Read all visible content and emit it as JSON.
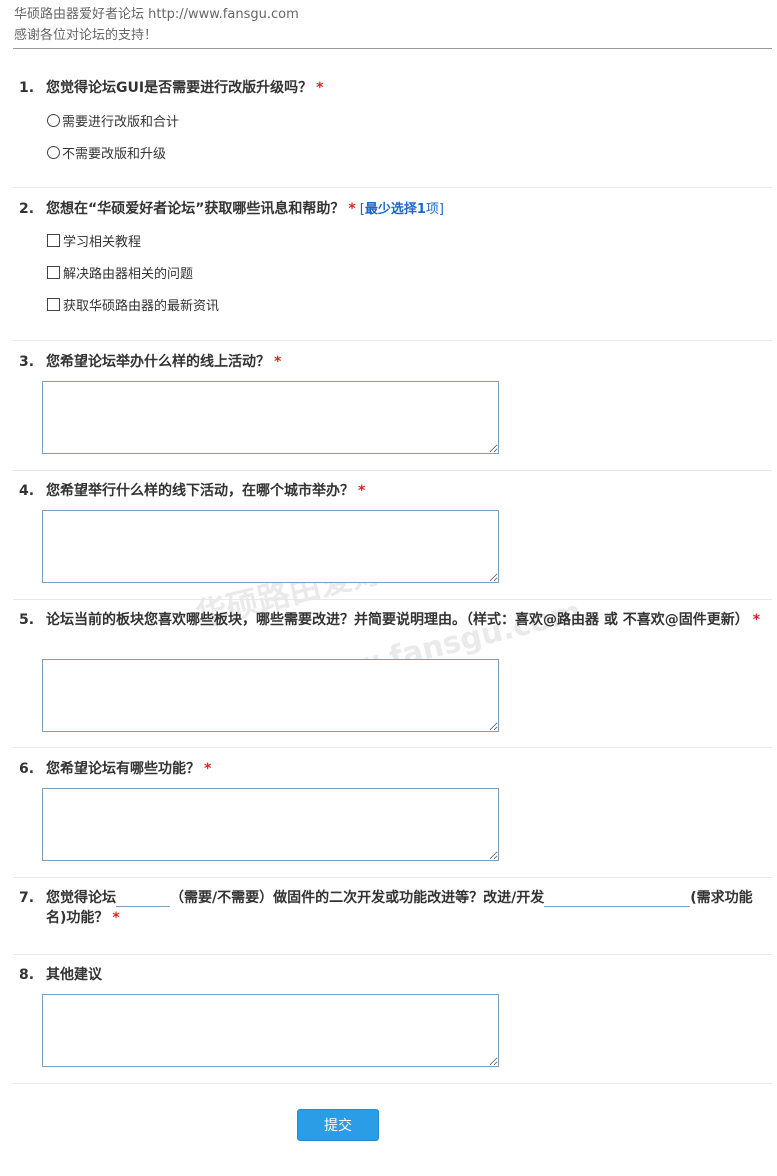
{
  "header": {
    "line1": "华硕路由器爱好者论坛 http://www.fansgu.com",
    "line2": "感谢各位对论坛的支持！"
  },
  "watermark": {
    "line1": "华硕路由爱好者论坛",
    "line2": "www.fansgu.com"
  },
  "questions": [
    {
      "num": "1.",
      "text": "您觉得论坛GUI是否需要进行改版升级吗？",
      "required": "*",
      "options": [
        "需要进行改版和合计",
        "不需要改版和升级"
      ]
    },
    {
      "num": "2.",
      "text": "您想在“华硕爱好者论坛”获取哪些讯息和帮助？",
      "required": "*",
      "hint_prefix": "[",
      "hint_bold": "最少选择1",
      "hint_suffix": "项]",
      "options": [
        "学习相关教程",
        "解决路由器相关的问题",
        "获取华硕路由器的最新资讯"
      ]
    },
    {
      "num": "3.",
      "text": "您希望论坛举办什么样的线上活动？",
      "required": "*"
    },
    {
      "num": "4.",
      "text": "您希望举行什么样的线下活动，在哪个城市举办？",
      "required": "*"
    },
    {
      "num": "5.",
      "text": "论坛当前的板块您喜欢哪些板块，哪些需要改进？并简要说明理由。（样式：喜欢@路由器 或 不喜欢@固件更新）",
      "required": "*"
    },
    {
      "num": "6.",
      "text": "您希望论坛有哪些功能？",
      "required": "*"
    },
    {
      "num": "7.",
      "part1": "您觉得论坛",
      "part2": "（需要/不需要）做固件的二次开发或功能改进等？改进/开发",
      "part3": "(需求功能名)功能？",
      "required": "*"
    },
    {
      "num": "8.",
      "text": "其他建议"
    }
  ],
  "submit_label": "提交"
}
